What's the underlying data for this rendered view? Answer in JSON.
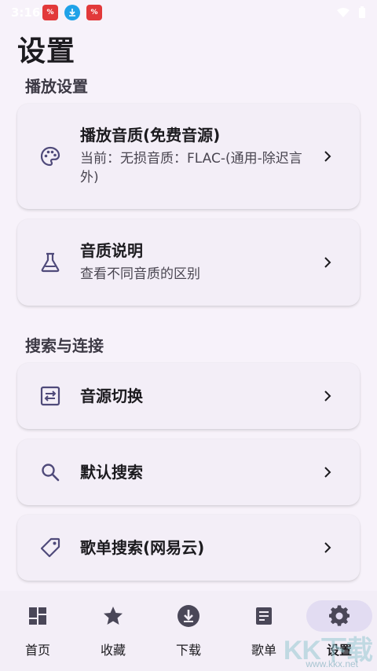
{
  "status_bar": {
    "time": "3:16"
  },
  "page": {
    "title": "设置"
  },
  "sections": [
    {
      "header": "播放设置",
      "items": [
        {
          "title": "播放音质(免费音源)",
          "subtitle": "当前：无损音质：FLAC-(通用-除迟言外)",
          "icon": "palette-icon"
        },
        {
          "title": "音质说明",
          "subtitle": "查看不同音质的区别",
          "icon": "flask-icon"
        }
      ]
    },
    {
      "header": "搜索与连接",
      "items": [
        {
          "title": "音源切换",
          "icon": "swap-icon"
        },
        {
          "title": "默认搜索",
          "icon": "search-icon"
        },
        {
          "title": "歌单搜索(网易云)",
          "icon": "tag-icon"
        }
      ]
    }
  ],
  "bottom_nav": [
    {
      "label": "首页",
      "icon": "dashboard-icon",
      "active": false
    },
    {
      "label": "收藏",
      "icon": "star-icon",
      "active": false
    },
    {
      "label": "下载",
      "icon": "download-icon",
      "active": false
    },
    {
      "label": "歌单",
      "icon": "list-icon",
      "active": false
    },
    {
      "label": "设置",
      "icon": "gear-icon",
      "active": true
    }
  ],
  "colors": {
    "background": "#f7f2fa",
    "card": "#f3eef7",
    "icon": "#4f4a7a",
    "active_pill": "#e2dcf2"
  },
  "watermark": {
    "text": "KK下载",
    "url": "www.kkx.net"
  }
}
